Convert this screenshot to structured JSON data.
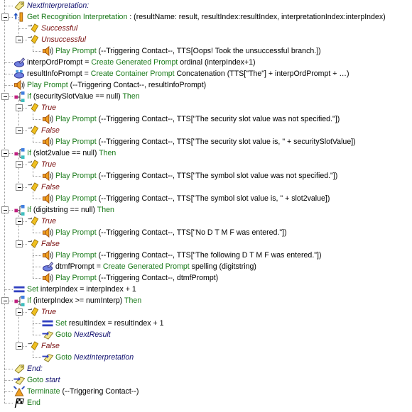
{
  "colors": {
    "keyword": "#1a7a1a",
    "label": "#10106e",
    "branch": "#7a1010",
    "text": "#000000"
  },
  "rows": [
    {
      "level": 0,
      "icon": "label-tag-icon",
      "segs": [
        {
          "s": "l",
          "t": "NextInterpretation:"
        }
      ]
    },
    {
      "level": 0,
      "icon": "recognition-icon",
      "expand": true,
      "segs": [
        {
          "s": "k",
          "t": "Get Recognition Interpretation"
        },
        {
          "s": "n",
          "t": " : (resultName: result, resultIndex:resultIndex, interpretationIndex:interpIndex)"
        }
      ]
    },
    {
      "level": 1,
      "icon": "branch-icon",
      "segs": [
        {
          "s": "b",
          "t": "Successful"
        }
      ]
    },
    {
      "level": 1,
      "icon": "branch-icon",
      "expand": true,
      "segs": [
        {
          "s": "b",
          "t": "Unsuccessful"
        }
      ]
    },
    {
      "level": 2,
      "icon": "speaker-icon",
      "segs": [
        {
          "s": "k",
          "t": "Play Prompt"
        },
        {
          "s": "n",
          "t": " (--Triggering Contact--, TTS[Oops! Took the unsuccessful branch.])"
        }
      ]
    },
    {
      "level": 0,
      "icon": "generated-prompt-icon",
      "segs": [
        {
          "s": "n",
          "t": "interpOrdPrompt = "
        },
        {
          "s": "k",
          "t": "Create Generated Prompt"
        },
        {
          "s": "n",
          "t": " ordinal (interpIndex+1)"
        }
      ]
    },
    {
      "level": 0,
      "icon": "container-prompt-icon",
      "segs": [
        {
          "s": "n",
          "t": "resultInfoPrompt = "
        },
        {
          "s": "k",
          "t": "Create Container Prompt"
        },
        {
          "s": "n",
          "t": " Concatenation (TTS[\"The\"] + interpOrdPrompt + …)"
        }
      ]
    },
    {
      "level": 0,
      "icon": "speaker-icon",
      "segs": [
        {
          "s": "k",
          "t": "Play Prompt"
        },
        {
          "s": "n",
          "t": " (--Triggering Contact--, resultInfoPrompt)"
        }
      ]
    },
    {
      "level": 0,
      "icon": "if-icon",
      "expand": true,
      "segs": [
        {
          "s": "k",
          "t": "If"
        },
        {
          "s": "n",
          "t": " (securitySlotValue == null) "
        },
        {
          "s": "k",
          "t": "Then"
        }
      ]
    },
    {
      "level": 1,
      "icon": "branch-icon",
      "expand": true,
      "segs": [
        {
          "s": "b",
          "t": "True"
        }
      ]
    },
    {
      "level": 2,
      "icon": "speaker-icon",
      "segs": [
        {
          "s": "k",
          "t": "Play Prompt"
        },
        {
          "s": "n",
          "t": " (--Triggering Contact--, TTS[\"The security slot value was not specified.\"])"
        }
      ]
    },
    {
      "level": 1,
      "icon": "branch-icon",
      "expand": true,
      "segs": [
        {
          "s": "b",
          "t": "False"
        }
      ]
    },
    {
      "level": 2,
      "icon": "speaker-icon",
      "segs": [
        {
          "s": "k",
          "t": "Play Prompt"
        },
        {
          "s": "n",
          "t": " (--Triggering Contact--, TTS[\"The security slot value is, \" + securitySlotValue])"
        }
      ]
    },
    {
      "level": 0,
      "icon": "if-icon",
      "expand": true,
      "segs": [
        {
          "s": "k",
          "t": "If"
        },
        {
          "s": "n",
          "t": " (slot2value == null) "
        },
        {
          "s": "k",
          "t": "Then"
        }
      ]
    },
    {
      "level": 1,
      "icon": "branch-icon",
      "expand": true,
      "segs": [
        {
          "s": "b",
          "t": "True"
        }
      ]
    },
    {
      "level": 2,
      "icon": "speaker-icon",
      "segs": [
        {
          "s": "k",
          "t": "Play Prompt"
        },
        {
          "s": "n",
          "t": " (--Triggering Contact--, TTS[\"The symbol slot value was not specified.\"])"
        }
      ]
    },
    {
      "level": 1,
      "icon": "branch-icon",
      "expand": true,
      "segs": [
        {
          "s": "b",
          "t": "False"
        }
      ]
    },
    {
      "level": 2,
      "icon": "speaker-icon",
      "segs": [
        {
          "s": "k",
          "t": "Play Prompt"
        },
        {
          "s": "n",
          "t": " (--Triggering Contact--, TTS[\"The symbol slot value is, \" + slot2value])"
        }
      ]
    },
    {
      "level": 0,
      "icon": "if-icon",
      "expand": true,
      "segs": [
        {
          "s": "k",
          "t": "If"
        },
        {
          "s": "n",
          "t": " (digitstring == null) "
        },
        {
          "s": "k",
          "t": "Then"
        }
      ]
    },
    {
      "level": 1,
      "icon": "branch-icon",
      "expand": true,
      "segs": [
        {
          "s": "b",
          "t": "True"
        }
      ]
    },
    {
      "level": 2,
      "icon": "speaker-icon",
      "segs": [
        {
          "s": "k",
          "t": "Play Prompt"
        },
        {
          "s": "n",
          "t": " (--Triggering Contact--, TTS[\"No D T M F was entered.\"])"
        }
      ]
    },
    {
      "level": 1,
      "icon": "branch-icon",
      "expand": true,
      "segs": [
        {
          "s": "b",
          "t": "False"
        }
      ]
    },
    {
      "level": 2,
      "icon": "speaker-icon",
      "segs": [
        {
          "s": "k",
          "t": "Play Prompt"
        },
        {
          "s": "n",
          "t": " (--Triggering Contact--, TTS[\"The following D T M F was entered.\"])"
        }
      ]
    },
    {
      "level": 2,
      "icon": "generated-prompt-icon",
      "segs": [
        {
          "s": "n",
          "t": "dtmfPrompt = "
        },
        {
          "s": "k",
          "t": "Create Generated Prompt"
        },
        {
          "s": "n",
          "t": " spelling (digitstring)"
        }
      ]
    },
    {
      "level": 2,
      "icon": "speaker-icon",
      "segs": [
        {
          "s": "k",
          "t": "Play Prompt"
        },
        {
          "s": "n",
          "t": " (--Triggering Contact--, dtmfPrompt)"
        }
      ]
    },
    {
      "level": 0,
      "icon": "set-icon",
      "segs": [
        {
          "s": "k",
          "t": "Set"
        },
        {
          "s": "n",
          "t": " interpIndex = interpIndex + 1"
        }
      ]
    },
    {
      "level": 0,
      "icon": "if-icon",
      "expand": true,
      "segs": [
        {
          "s": "k",
          "t": "If"
        },
        {
          "s": "n",
          "t": " (interpIndex >= numInterp) "
        },
        {
          "s": "k",
          "t": "Then"
        }
      ]
    },
    {
      "level": 1,
      "icon": "branch-icon",
      "expand": true,
      "segs": [
        {
          "s": "b",
          "t": "True"
        }
      ]
    },
    {
      "level": 2,
      "icon": "set-icon",
      "segs": [
        {
          "s": "k",
          "t": "Set"
        },
        {
          "s": "n",
          "t": " resultIndex = resultIndex + 1"
        }
      ]
    },
    {
      "level": 2,
      "icon": "goto-icon",
      "segs": [
        {
          "s": "k",
          "t": "Goto "
        },
        {
          "s": "l",
          "t": "NextResult"
        }
      ]
    },
    {
      "level": 1,
      "icon": "branch-icon",
      "expand": true,
      "segs": [
        {
          "s": "b",
          "t": "False"
        }
      ]
    },
    {
      "level": 2,
      "icon": "goto-icon",
      "segs": [
        {
          "s": "k",
          "t": "Goto "
        },
        {
          "s": "l",
          "t": "NextInterpretation"
        }
      ]
    },
    {
      "level": 0,
      "icon": "label-tag-icon",
      "segs": [
        {
          "s": "l",
          "t": "End:"
        }
      ]
    },
    {
      "level": 0,
      "icon": "goto-icon",
      "segs": [
        {
          "s": "k",
          "t": "Goto "
        },
        {
          "s": "l",
          "t": "start"
        }
      ]
    },
    {
      "level": 0,
      "icon": "terminate-icon",
      "segs": [
        {
          "s": "k",
          "t": "Terminate"
        },
        {
          "s": "n",
          "t": " (--Triggering Contact--)"
        }
      ]
    },
    {
      "level": 0,
      "icon": "checkered-flag-icon",
      "segs": [
        {
          "s": "k",
          "t": "End"
        }
      ]
    }
  ]
}
